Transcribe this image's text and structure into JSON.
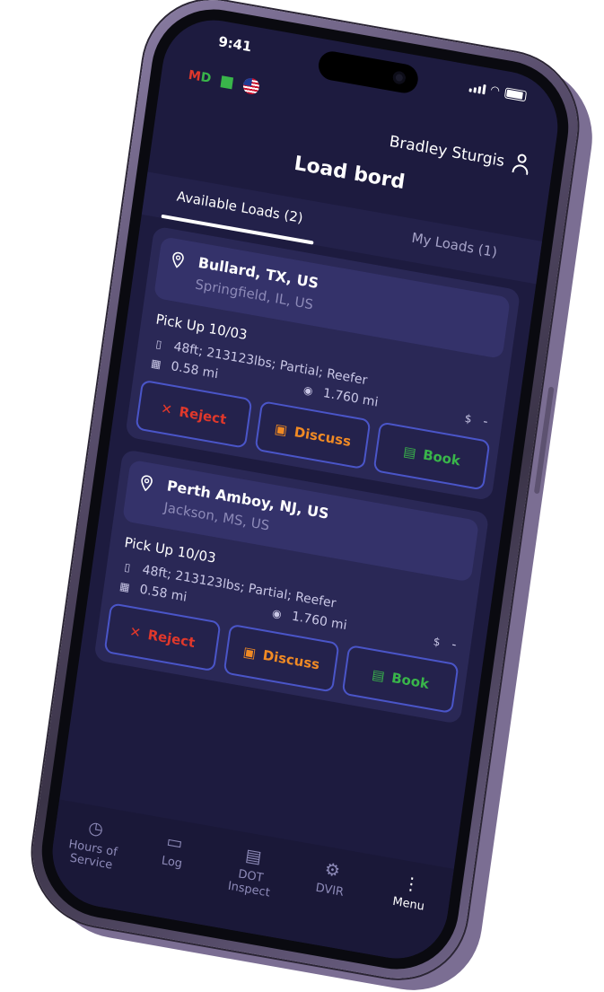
{
  "status": {
    "time": "9:41"
  },
  "badges": {
    "md_m": "M",
    "md_d": "D"
  },
  "user": {
    "name": "Bradley Sturgis"
  },
  "page": {
    "title": "Load bord"
  },
  "tabs": [
    {
      "label": "Available Loads (2)"
    },
    {
      "label": "My Loads (1)"
    }
  ],
  "loads": [
    {
      "from": "Bullard, TX, US",
      "to": "Springfield, IL, US",
      "pickup": "Pick Up 10/03",
      "specs": "48ft; 213123lbs; Partial; Reefer",
      "distance_a": "0.58 mi",
      "distance_b": "1.760 mi",
      "rate": "-"
    },
    {
      "from": "Perth Amboy, NJ, US",
      "to": "Jackson, MS, US",
      "pickup": "Pick Up 10/03",
      "specs": "48ft; 213123lbs; Partial; Reefer",
      "distance_a": "0.58 mi",
      "distance_b": "1.760 mi",
      "rate": "-"
    }
  ],
  "actions": {
    "reject": "Reject",
    "discuss": "Discuss",
    "book": "Book"
  },
  "nav": [
    {
      "label": "Hours of Service",
      "icon": "stopwatch-icon"
    },
    {
      "label": "Log",
      "icon": "log-icon"
    },
    {
      "label": "DOT Inspect",
      "icon": "clipboard-icon"
    },
    {
      "label": "DVIR",
      "icon": "gear-icon"
    },
    {
      "label": "Menu",
      "icon": "menu-icon"
    }
  ],
  "colors": {
    "background": "#1d1b3f",
    "card": "#2a2856",
    "reject": "#e0382b",
    "discuss": "#f08a24",
    "book": "#39b54a",
    "button_border": "#4a55c8"
  }
}
